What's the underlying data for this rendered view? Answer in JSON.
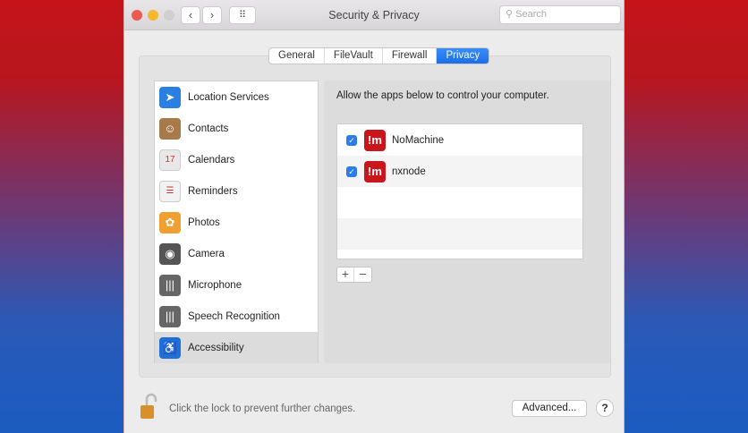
{
  "window": {
    "title": "Security & Privacy",
    "search_placeholder": "Search",
    "back": "‹",
    "forward": "›",
    "grid": "⠿"
  },
  "tabs": [
    "General",
    "FileVault",
    "Firewall",
    "Privacy"
  ],
  "sidebar": [
    {
      "label": "Location Services",
      "icon": "➤",
      "color": "#2a7fe0"
    },
    {
      "label": "Contacts",
      "icon": "☺",
      "color": "#a8794a"
    },
    {
      "label": "Calendars",
      "icon": "17",
      "color": "#e8e8e8"
    },
    {
      "label": "Reminders",
      "icon": "☰",
      "color": "#f2f2f2"
    },
    {
      "label": "Photos",
      "icon": "✿",
      "color": "#f0a030"
    },
    {
      "label": "Camera",
      "icon": "◉",
      "color": "#555555"
    },
    {
      "label": "Microphone",
      "icon": "|||",
      "color": "#666666"
    },
    {
      "label": "Speech Recognition",
      "icon": "|||",
      "color": "#666666"
    },
    {
      "label": "Accessibility",
      "icon": "♿",
      "color": "#1f6fd6"
    }
  ],
  "main": {
    "description": "Allow the apps below to control your computer.",
    "apps": [
      {
        "name": "NoMachine",
        "checked": true,
        "icon": "!m"
      },
      {
        "name": "nxnode",
        "checked": true,
        "icon": "!m"
      }
    ],
    "add": "+",
    "remove": "−"
  },
  "footer": {
    "lock_text": "Click the lock to prevent further changes.",
    "advanced": "Advanced...",
    "help": "?"
  }
}
